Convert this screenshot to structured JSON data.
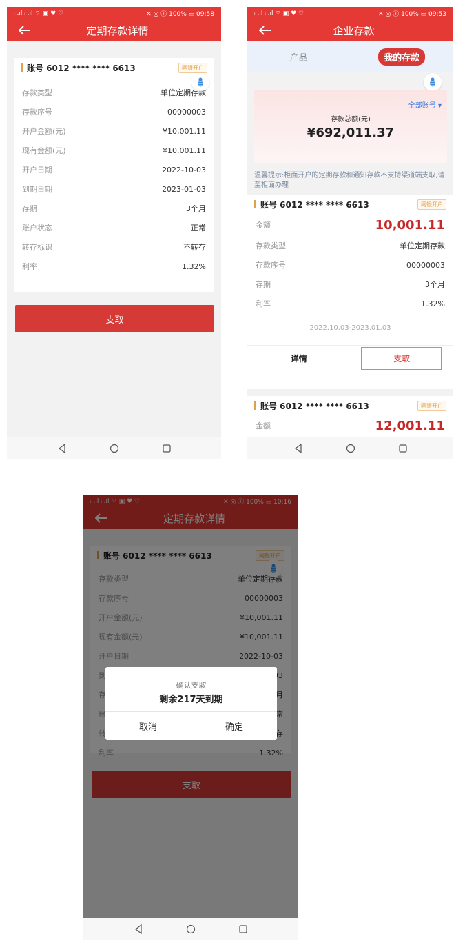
{
  "colors": {
    "brand_red": "#e53935",
    "button_red": "#d63a36",
    "amount_red": "#c62828",
    "tag_orange": "#e0a14b",
    "link_blue": "#3c7be0"
  },
  "detail_screen": {
    "status": {
      "left": "ᵢ .ıl ᵢ .ıl ⌔ ▣ ♥ ♡",
      "right": "✕ ◎ ⓘ 100% ▭ 09:58"
    },
    "title": "定期存款详情",
    "account": {
      "label": "账号 6012 **** **** 6613",
      "tag": "网银开户"
    },
    "rows": [
      {
        "key": "存款类型",
        "value": "单位定期存款"
      },
      {
        "key": "存款序号",
        "value": "00000003"
      },
      {
        "key": "开户金额(元)",
        "value": "¥10,001.11"
      },
      {
        "key": "现有金额(元)",
        "value": "¥10,001.11"
      },
      {
        "key": "开户日期",
        "value": "2022-10-03"
      },
      {
        "key": "到期日期",
        "value": "2023-01-03"
      },
      {
        "key": "存期",
        "value": "3个月"
      },
      {
        "key": "账户状态",
        "value": "正常"
      },
      {
        "key": "转存标识",
        "value": "不转存"
      },
      {
        "key": "利率",
        "value": "1.32%"
      }
    ],
    "withdraw_label": "支取"
  },
  "deposit_screen": {
    "status": {
      "left": "ᵢ .ıl ᵢ .ıl ⌔ ▣ ♥ ♡",
      "right": "✕ ◎ ⓘ 100% ▭ 09:53"
    },
    "title": "企业存款",
    "tabs": {
      "product": "产品",
      "mine": "我的存款"
    },
    "all_accounts": "全部账号 ▾",
    "total_label": "存款总额(元)",
    "total_amount": "¥692,011.37",
    "tip": "温馨提示:柜面开户的定期存款和通知存款不支持渠道端支取,请至柜面办理",
    "account1": {
      "label": "账号 6012 **** **** 6613",
      "tag": "网银开户",
      "amount_key": "金额",
      "amount": "10,001.11",
      "rows": [
        {
          "key": "存款类型",
          "value": "单位定期存款"
        },
        {
          "key": "存款序号",
          "value": "00000003"
        },
        {
          "key": "存期",
          "value": "3个月"
        },
        {
          "key": "利率",
          "value": "1.32%"
        }
      ],
      "period": "2022.10.03-2023.01.03",
      "detail_label": "详情",
      "withdraw_label": "支取"
    },
    "account2": {
      "label": "账号 6012 **** **** 6613",
      "tag": "网银开户",
      "amount_key": "金额",
      "amount": "12,001.11"
    }
  },
  "confirm_screen": {
    "status": {
      "left": "ᵢ .ıl ᵢ .ıl ⌔ ▣ ♥ ♡",
      "right": "✕ ◎ ⓘ 100% ▭ 10:16"
    },
    "title": "定期存款详情",
    "dialog": {
      "title": "确认支取",
      "message": "剩余217天到期",
      "cancel": "取消",
      "ok": "确定"
    }
  }
}
